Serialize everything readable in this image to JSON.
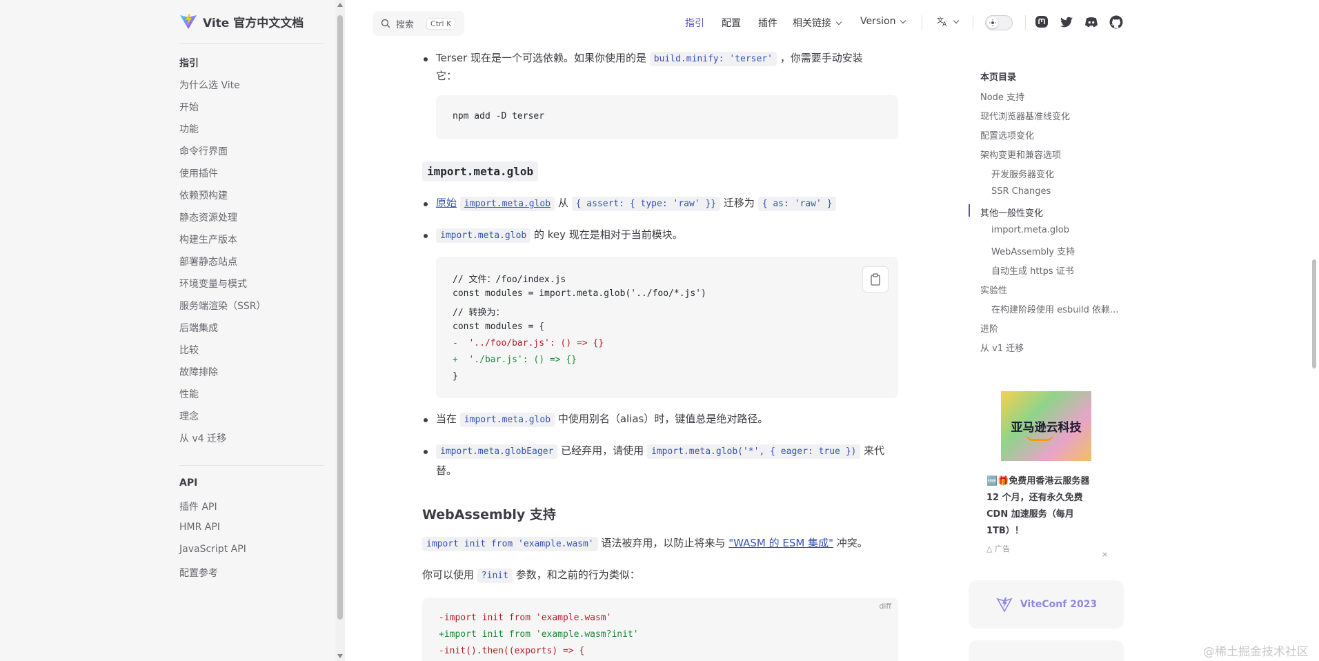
{
  "sidebar": {
    "brand_title": "Vite 官方中文文档",
    "groups": [
      {
        "title": "指引",
        "items": [
          "为什么选 Vite",
          "开始",
          "功能",
          "命令行界面",
          "使用插件",
          "依赖预构建",
          "静态资源处理",
          "构建生产版本",
          "部署静态站点",
          "环境变量与模式",
          "服务端渲染（SSR）",
          "后端集成",
          "比较",
          "故障排除",
          "性能",
          "理念",
          "从 v4 迁移"
        ]
      },
      {
        "title": "API",
        "items": [
          "插件 API",
          "HMR API",
          "JavaScript API",
          "配置参考"
        ]
      }
    ]
  },
  "topbar": {
    "search_label": "搜索",
    "search_kbd": "Ctrl K",
    "nav": [
      "指引",
      "配置",
      "插件",
      "相关链接",
      "Version"
    ],
    "active_nav": "指引",
    "social_icons": [
      "mastodon-icon",
      "twitter-icon",
      "discord-icon",
      "github-icon"
    ]
  },
  "content": {
    "terser_line1": "Terser 现在是一个可选依赖。如果你使用的是",
    "terser_code": "build.minify: 'terser'",
    "terser_line1b": "，你需要手动安装",
    "terser_line2": "它：",
    "terser_cmd": "npm add -D terser",
    "glob_heading": "import.meta.glob",
    "b1_link": "原始",
    "b1_code1": "import.meta.glob",
    "b1_from": "从",
    "b1_code2": "{ assert: { type: 'raw' }}",
    "b1_mid": "迁移为",
    "b1_code3": "{ as: 'raw' }",
    "b2_code": "import.meta.glob",
    "b2_text": "的 key 现在是相对于当前模块。",
    "code1": [
      {
        "text": "// 文件：/foo/index.js",
        "type": "normal"
      },
      {
        "text": "const modules = import.meta.glob('../foo/*.js')",
        "type": "normal"
      },
      {
        "text": "// 转换为：",
        "type": "normal"
      },
      {
        "text": "const modules = {",
        "type": "normal"
      },
      {
        "text": "-  '../foo/bar.js': () => {}",
        "type": "del"
      },
      {
        "text": "+  './bar.js': () => {}",
        "type": "add"
      },
      {
        "text": "}",
        "type": "normal"
      }
    ],
    "b3_pre": "当在",
    "b3_code": "import.meta.glob",
    "b3_post": "中使用别名（alias）时，键值总是绝对路径。",
    "b4_code1": "import.meta.globEager",
    "b4_mid": "已经弃用，请使用",
    "b4_code2": "import.meta.glob('*', { eager: true })",
    "b4_post": "来代",
    "b4_line2": "替。",
    "wasm_heading": "WebAssembly 支持",
    "wasm_code": "import init from 'example.wasm'",
    "wasm_mid": "语法被弃用，以防止将来与",
    "wasm_link": "\"WASM 的 ESM 集成\"",
    "wasm_post": "冲突。",
    "init_pre": "你可以使用",
    "init_code": "?init",
    "init_post": "参数，和之前的行为类似：",
    "diff_label": "diff",
    "code2": [
      {
        "text": "-import init from 'example.wasm'",
        "type": "del"
      },
      {
        "text": "+import init from 'example.wasm?init'",
        "type": "add"
      },
      {
        "text": "-init().then((exports) => {",
        "type": "del"
      }
    ]
  },
  "outline": {
    "title": "本页目录",
    "items": [
      {
        "label": "Node 支持",
        "level": 1
      },
      {
        "label": "现代浏览器基准线变化",
        "level": 1
      },
      {
        "label": "配置选项变化",
        "level": 1
      },
      {
        "label": "架构变更和兼容选项",
        "level": 1
      },
      {
        "label": "开发服务器变化",
        "level": 2
      },
      {
        "label": "SSR Changes",
        "level": 2
      },
      {
        "label": "其他一般性变化",
        "level": 1
      },
      {
        "label": "import.meta.glob",
        "level": 2
      },
      {
        "label": "WebAssembly 支持",
        "level": 2
      },
      {
        "label": "自动生成 https 证书",
        "level": 2
      },
      {
        "label": "实验性",
        "level": 1
      },
      {
        "label": "在构建阶段使用 esbuild 依赖...",
        "level": 2
      },
      {
        "label": "进阶",
        "level": 1
      },
      {
        "label": "从 v1 迁移",
        "level": 1
      }
    ],
    "active_index": 6
  },
  "ad": {
    "image_text": "亚马逊云科技",
    "line1": "🆓🎁免费用香港云服务器",
    "line2": "12 个月，还有永久免费",
    "line3": "CDN 加速服务（每月",
    "line4": "1TB）！",
    "tag": "广告",
    "close": "×"
  },
  "viteconf_label": "ViteConf 2023",
  "watermark": "@稀土掘金技术社区",
  "colors": {
    "accent": "#5a4fcf",
    "code_inline": "#3451b2",
    "diff_del": "#b31d28",
    "diff_add": "#22863a"
  }
}
